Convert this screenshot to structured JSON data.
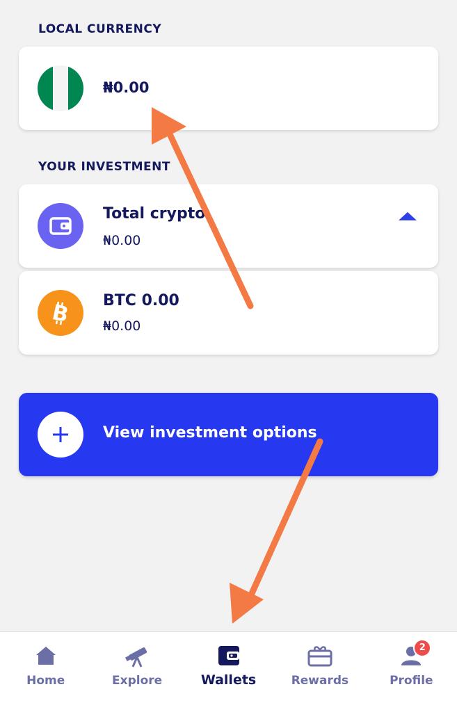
{
  "local_currency": {
    "section_label": "LOCAL CURRENCY",
    "amount": "₦0.00",
    "flag_icon": "nigeria-flag-icon",
    "flag_colors": [
      "#008751",
      "#ffffff",
      "#008751"
    ]
  },
  "investment": {
    "section_label": "YOUR INVESTMENT",
    "total": {
      "title": "Total crypto",
      "amount": "₦0.00",
      "icon": "wallet-icon",
      "icon_color": "#6a63f1",
      "expanded": true
    },
    "btc": {
      "title": "BTC 0.00",
      "amount": "₦0.00",
      "icon": "bitcoin-icon",
      "icon_color": "#f7931a"
    }
  },
  "cta": {
    "label": "View investment options",
    "icon": "plus-icon",
    "color": "#2638f0"
  },
  "bottom_nav": {
    "items": [
      {
        "label": "Home",
        "icon": "home-icon",
        "active": false
      },
      {
        "label": "Explore",
        "icon": "telescope-icon",
        "active": false
      },
      {
        "label": "Wallets",
        "icon": "wallet-icon",
        "active": true
      },
      {
        "label": "Rewards",
        "icon": "gift-card-icon",
        "active": false
      },
      {
        "label": "Profile",
        "icon": "user-icon",
        "active": false,
        "badge": "2"
      }
    ]
  },
  "colors": {
    "navy": "#14195e",
    "accent_blue": "#2638f0",
    "annotation_arrow": "#f47a45",
    "badge_red": "#ef4b4b"
  }
}
